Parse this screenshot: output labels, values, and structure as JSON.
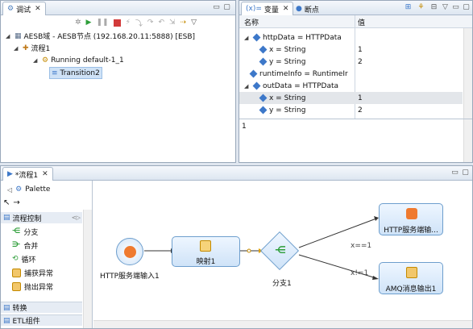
{
  "debug_view": {
    "tab_label": "调试",
    "tree": [
      {
        "label": "AESB域 - AESB节点 (192.168.20.11:5888) [ESB]"
      },
      {
        "label": "流程1"
      },
      {
        "label": "Running default-1_1"
      },
      {
        "label": "Transition2"
      }
    ]
  },
  "variables_view": {
    "tab_label": "变量",
    "tab2_label": "断点",
    "col_name": "名称",
    "col_value": "值",
    "rows": [
      {
        "name": "httpData  =  HTTPData",
        "value": ""
      },
      {
        "name": "x  =  String",
        "value": "1"
      },
      {
        "name": "y  =  String",
        "value": "2"
      },
      {
        "name": "runtimeInfo  =  RuntimeIr",
        "value": ""
      },
      {
        "name": "outData  =  HTTPData",
        "value": ""
      },
      {
        "name": "x  =  String",
        "value": "1"
      },
      {
        "name": "y  =  String",
        "value": "2"
      }
    ],
    "detail_text": "1"
  },
  "editor": {
    "tab_label": "*流程1",
    "palette": {
      "title": "Palette",
      "section": "流程控制",
      "items": [
        "分支",
        "合并",
        "循环",
        "捕获异常",
        "抛出异常"
      ],
      "groups": [
        "转换",
        "ETL组件"
      ]
    },
    "nodes": {
      "http_in": "HTTP服务端输入1",
      "map": "映射1",
      "branch": "分支1",
      "http_out": "HTTP服务端输...",
      "amq_out": "AMQ消息输出1"
    },
    "edges": {
      "cond_top": "x==1",
      "cond_bottom": "x!=1"
    }
  },
  "colors": {
    "accent": "#3d78c9",
    "selection": "#cfe2f6",
    "node_fill": "#cfe3f8",
    "branch_green": "#2e9e3a"
  }
}
